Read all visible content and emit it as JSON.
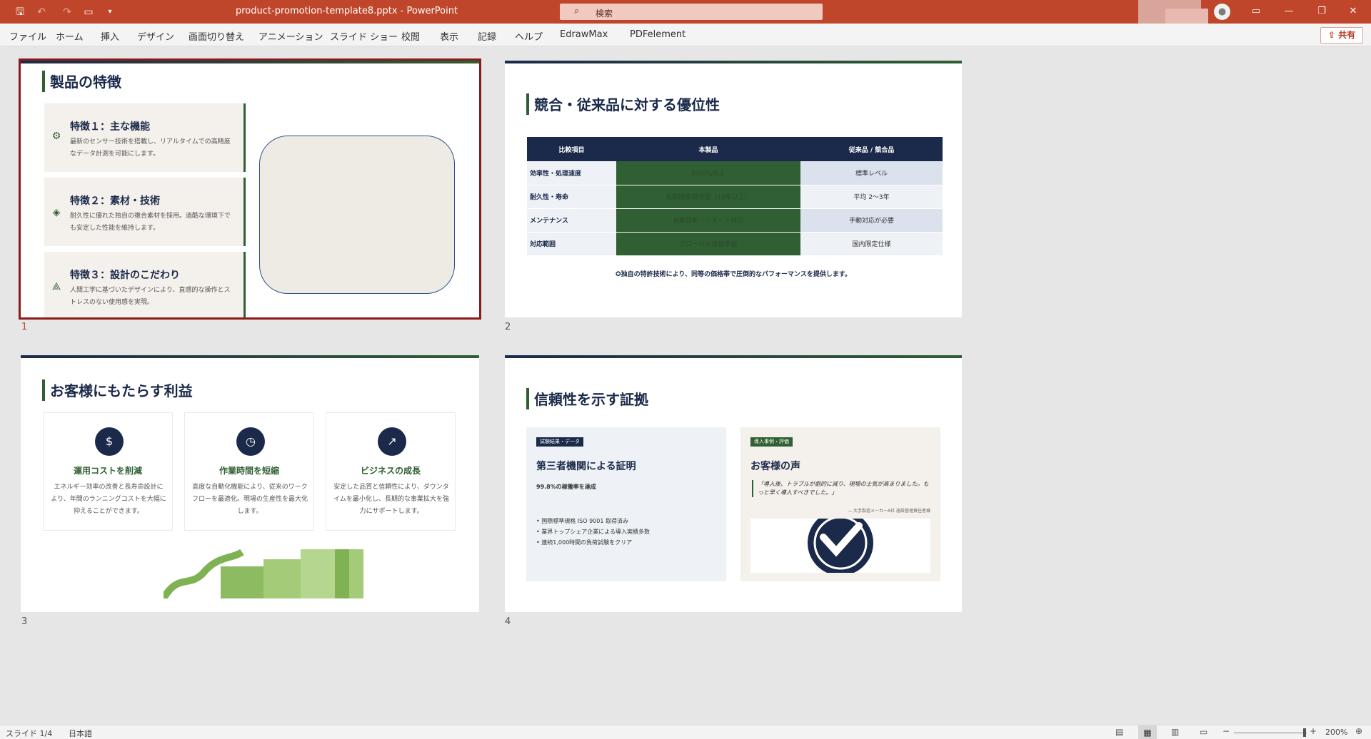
{
  "window": {
    "doc_title": "product-promotion-template8.pptx  -  PowerPoint",
    "search_placeholder": "検索",
    "share_label": "共有"
  },
  "menu": [
    "ファイル",
    "ホーム",
    "挿入",
    "デザイン",
    "画面切り替え",
    "アニメーション",
    "スライド ショー",
    "校閲",
    "表示",
    "記録",
    "ヘルプ",
    "EdrawMax",
    "PDFelement"
  ],
  "slides": [
    {
      "number": "1",
      "heading": "製品の特徴",
      "features": [
        {
          "title": "特徴１：主な機能",
          "desc": "最新のセンサー技術を搭載し、リアルタイムでの高精度なデータ計測を可能にします。"
        },
        {
          "title": "特徴２：素材・技術",
          "desc": "耐久性に優れた独自の複合素材を採用。過酷な環境下でも安定した性能を維持します。"
        },
        {
          "title": "特徴３：設計のこだわり",
          "desc": "人間工学に基づいたデザインにより、直感的な操作とストレスのない使用感を実現。"
        }
      ]
    },
    {
      "number": "2",
      "heading": "競合・従来品に対する優位性",
      "table_headers": [
        "比較項目",
        "本製品",
        "従来品 / 競合品"
      ],
      "rows": [
        [
          "効率性・処理速度",
          "約50%向上",
          "標準レベル"
        ],
        [
          "耐久性・寿命",
          "長期間使用可能（10年以上）",
          "平均 2〜3年"
        ],
        [
          "メンテナンス",
          "自動診断・リモート対応",
          "手動対応が必要"
        ],
        [
          "対応範囲",
          "グローバル規格準拠",
          "国内限定仕様"
        ]
      ],
      "note": "独自の特許技術により、同等の価格帯で圧倒的なパフォーマンスを提供します。"
    },
    {
      "number": "3",
      "heading": "お客様にもたらす利益",
      "benefits": [
        {
          "title": "運用コストを削減",
          "desc": "エネルギー効率の改善と長寿命設計により、年間のランニングコストを大幅に抑えることができます。"
        },
        {
          "title": "作業時間を短縮",
          "desc": "高度な自動化機能により、従来のワークフローを最適化。現場の生産性を最大化します。"
        },
        {
          "title": "ビジネスの成長",
          "desc": "安定した品質と信頼性により、ダウンタイムを最小化し、長期的な事業拡大を強力にサポートします。"
        }
      ]
    },
    {
      "number": "4",
      "heading": "信頼性を示す証拠",
      "left_card": {
        "tag": "試験結果・データ",
        "title": "第三者機関による証明",
        "stat": "99.8%の稼働率を達成",
        "bullets": [
          "国際標準規格 ISO 9001 取得済み",
          "業界トップシェア企業による導入実績多数",
          "連続1,000時間の負荷試験をクリア"
        ]
      },
      "right_card": {
        "tag": "導入事例・評価",
        "title": "お客様の声",
        "quote": "「導入後、トラブルが劇的に減り、現場の士気が高まりました。もっと早く導入すべきでした。」",
        "attribution": "― 大手製造メーカーA社 施設管理責任者様"
      }
    }
  ],
  "status": {
    "slide_counter": "スライド 1/4",
    "language": "日本語",
    "zoom": "200%"
  }
}
